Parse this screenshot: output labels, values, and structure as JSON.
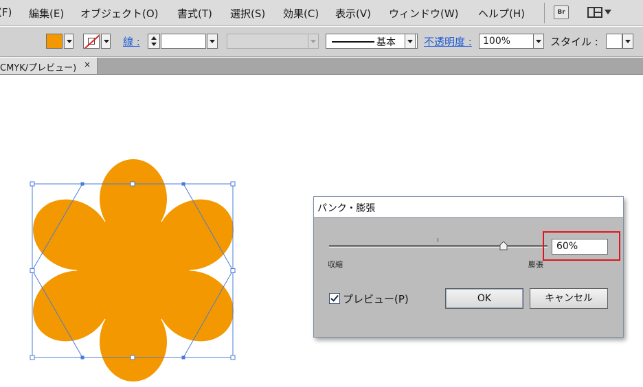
{
  "menu": {
    "items": [
      "(F)",
      "編集(E)",
      "オブジェクト(O)",
      "書式(T)",
      "選択(S)",
      "効果(C)",
      "表示(V)",
      "ウィンドウ(W)",
      "ヘルプ(H)"
    ],
    "bridge_label": "Br"
  },
  "control_bar": {
    "fill_color": "#f39800",
    "stroke_label": "線 :",
    "stroke_style": "基本",
    "opacity_label": "不透明度 :",
    "opacity_value": "100%",
    "style_label": "スタイル :"
  },
  "tab": {
    "label": "CMYK/プレビュー)",
    "close": "×"
  },
  "shape": {
    "fill_color": "#f39800",
    "selection_color": "#4a7bd8"
  },
  "dialog": {
    "title": "パンク・膨張",
    "slider_left_label": "収縮",
    "slider_right_label": "膨張",
    "slider_value_percent": 60,
    "value_text": "60%",
    "preview_label": "プレビュー(P)",
    "preview_checked": true,
    "ok_label": "OK",
    "cancel_label": "キャンセル",
    "highlight_color": "#e0141e"
  }
}
